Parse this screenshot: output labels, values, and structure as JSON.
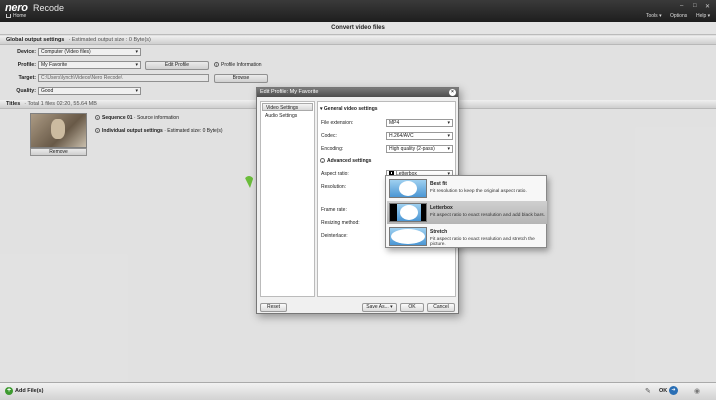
{
  "app": {
    "logo": "nero",
    "name": "Recode",
    "home_label": "Home",
    "menu": [
      "Tools",
      "Options",
      "Help"
    ],
    "window_controls": [
      "–",
      "□",
      "✕"
    ]
  },
  "page": {
    "title": "Convert video files"
  },
  "global": {
    "section_title": "Global output settings",
    "estimated": "· Estimated output size : 0 Byte(s)",
    "device_label": "Device:",
    "device_value": "Computer (Video files)",
    "profile_label": "Profile:",
    "profile_value": "My Favorite",
    "edit_profile": "Edit Profile",
    "profile_info": "Profile Information",
    "target_label": "Target:",
    "target_value": "C:\\Users\\lynch\\Videos\\Nero Recode\\",
    "browse": "Browse",
    "quality_label": "Quality:",
    "quality_value": "Good"
  },
  "titles": {
    "section_title": "Titles",
    "summary": "· Total 1 files 02:20, 55.64 MB",
    "sequence": "Sequence 01",
    "sequence_sub": "· Source information",
    "individual": "Individual output settings",
    "individual_sub": "· Estimated size: 0 Byte(s)",
    "remove": "Remove"
  },
  "dialog": {
    "title": "Edit Profile: My Favorite",
    "nav": [
      "Video Settings",
      "Audio Settings"
    ],
    "general_heading": "General video settings",
    "file_ext_label": "File extension:",
    "file_ext_value": "MP4",
    "codec_label": "Codec:",
    "codec_value": "H.264/AVC",
    "encoding_label": "Encoding:",
    "encoding_value": "High quality (2-pass)",
    "advanced_heading": "Advanced settings",
    "aspect_label": "Aspect ratio:",
    "aspect_value": "Letterbox",
    "resolution_label": "Resolution:",
    "frame_rate_label": "Frame rate:",
    "resizing_label": "Resizing method:",
    "deinterlace_label": "Deinterlace:",
    "reset": "Reset",
    "save_as": "Save As...",
    "ok": "OK",
    "cancel": "Cancel"
  },
  "aspect_options": [
    {
      "title": "Best fit",
      "desc": "Fit resolution to keep the original aspect ratio."
    },
    {
      "title": "Letterbox",
      "desc": "Fit aspect ratio to exact resolution and add black bars."
    },
    {
      "title": "Stretch",
      "desc": "Fit aspect ratio to exact resolution and stretch the picture."
    }
  ],
  "bottom": {
    "add_files": "Add File(s)",
    "ok": "OK"
  }
}
